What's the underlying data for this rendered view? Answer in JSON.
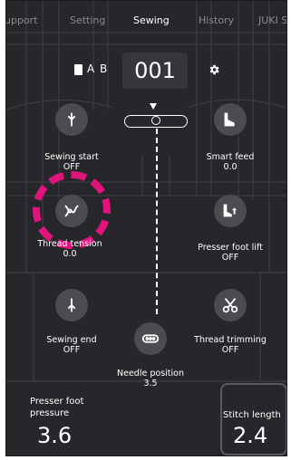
{
  "tabs": [
    "upport",
    "Setting",
    "Sewing",
    "History",
    "JUKI S"
  ],
  "active_tab": "Sewing",
  "header": {
    "ab_label": "A B",
    "pattern_number": "001"
  },
  "controls": {
    "sewing_start": {
      "label": "Sewing start",
      "value": "OFF"
    },
    "smart_feed": {
      "label": "Smart feed",
      "value": "0.0"
    },
    "thread_tension": {
      "label": "Thread tension",
      "value": "0.0"
    },
    "presser_foot_lift": {
      "label": "Presser foot lift",
      "value": "OFF"
    },
    "sewing_end": {
      "label": "Sewing end",
      "value": "OFF"
    },
    "thread_trimming": {
      "label": "Thread trimming",
      "value": "OFF"
    },
    "needle_position": {
      "label": "Needle position",
      "value": "3.5"
    }
  },
  "presser_foot_pressure": {
    "label_line1": "Presser foot",
    "label_line2": "pressure",
    "value": "3.6"
  },
  "stitch_length": {
    "label": "Stitch length",
    "value": "2.4"
  },
  "colors": {
    "background": "#26272a",
    "button": "#4b4c50",
    "highlight": "#e0147c"
  },
  "icons": [
    "book-icon",
    "gear-icon",
    "sewing-start-icon",
    "smart-feed-icon",
    "thread-tension-icon",
    "presser-foot-lift-icon",
    "sewing-end-icon",
    "thread-trimming-icon",
    "needle-position-icon"
  ]
}
